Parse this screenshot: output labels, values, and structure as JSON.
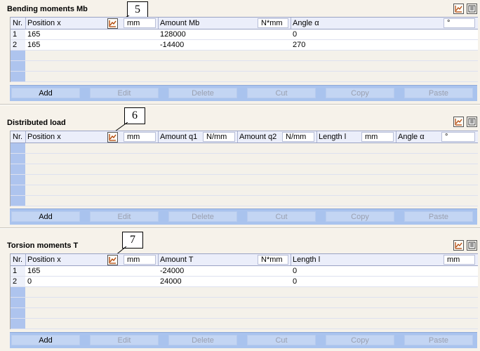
{
  "sections": [
    {
      "title": "Bending moments Mb",
      "callout": "5",
      "columns": {
        "nr": "Nr.",
        "position": "Position x",
        "position_unit": "mm",
        "amount": "Amount Mb",
        "amount_unit": "N*mm",
        "angle": "Angle α",
        "angle_unit": "°"
      },
      "rows": [
        {
          "nr": "1",
          "position": "165",
          "amount": "128000",
          "angle": "0"
        },
        {
          "nr": "2",
          "position": "165",
          "amount": "-14400",
          "angle": "270"
        }
      ]
    },
    {
      "title": "Distributed load",
      "callout": "6",
      "columns": {
        "nr": "Nr.",
        "position": "Position x",
        "position_unit": "mm",
        "q1": "Amount q1",
        "q1_unit": "N/mm",
        "q2": "Amount q2",
        "q2_unit": "N/mm",
        "length": "Length l",
        "length_unit": "mm",
        "angle": "Angle α",
        "angle_unit": "°"
      },
      "rows": []
    },
    {
      "title": "Torsion moments T",
      "callout": "7",
      "columns": {
        "nr": "Nr.",
        "position": "Position x",
        "position_unit": "mm",
        "amount": "Amount T",
        "amount_unit": "N*mm",
        "length": "Length l",
        "length_unit": "mm"
      },
      "rows": [
        {
          "nr": "1",
          "position": "165",
          "amount": "-24000",
          "length": "0"
        },
        {
          "nr": "2",
          "position": "0",
          "amount": "24000",
          "length": "0"
        }
      ]
    }
  ],
  "buttons": {
    "add": "Add",
    "edit": "Edit",
    "delete": "Delete",
    "cut": "Cut",
    "copy": "Copy",
    "paste": "Paste"
  },
  "icons": {
    "graph": "graph-icon",
    "notes": "notes-icon"
  },
  "colors": {
    "header_bg": "#ebeefa",
    "button_bar": "#a9c3ee",
    "button_face": "#c3d5f3",
    "row_marker": "#aec4ee",
    "panel_bg": "#f6f2ea"
  }
}
